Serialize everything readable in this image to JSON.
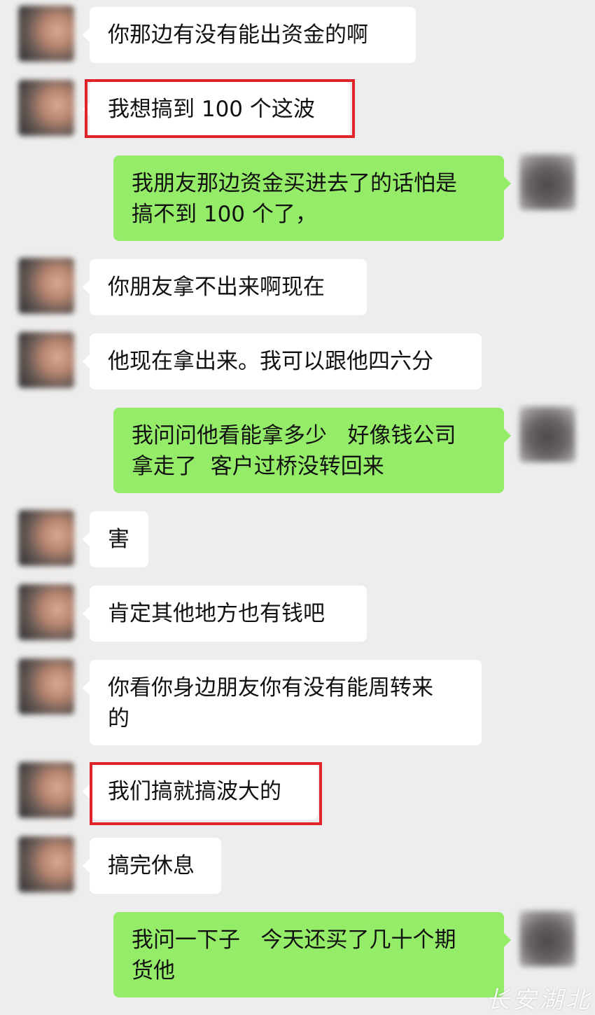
{
  "messages": [
    {
      "side": "in",
      "text": "你那边有没有能出资金的啊"
    },
    {
      "side": "in",
      "text": "我想搞到 100 个这波",
      "highlighted": true
    },
    {
      "side": "out",
      "text": "我朋友那边资金买进去了的话怕是\n搞不到 100 个了，"
    },
    {
      "side": "in",
      "text": "你朋友拿不出来啊现在"
    },
    {
      "side": "in",
      "text": "他现在拿出来。我可以跟他四六分"
    },
    {
      "side": "out",
      "text": "我问问他看能拿多少   好像钱公司\n拿走了  客户过桥没转回来"
    },
    {
      "side": "in",
      "text": "害"
    },
    {
      "side": "in",
      "text": "肯定其他地方也有钱吧"
    },
    {
      "side": "in",
      "text": "你看你身边朋友你有没有能周转来\n的"
    },
    {
      "side": "in",
      "text": "我们搞就搞波大的",
      "highlighted": true
    },
    {
      "side": "in",
      "text": "搞完休息"
    },
    {
      "side": "out",
      "text": "我问一下子   今天还买了几十个期\n货他"
    }
  ],
  "colors": {
    "background": "#ededed",
    "incoming_bubble": "#ffffff",
    "outgoing_bubble": "#95ec69",
    "highlight_box": "#e0242c"
  },
  "watermark": "长安湖北"
}
